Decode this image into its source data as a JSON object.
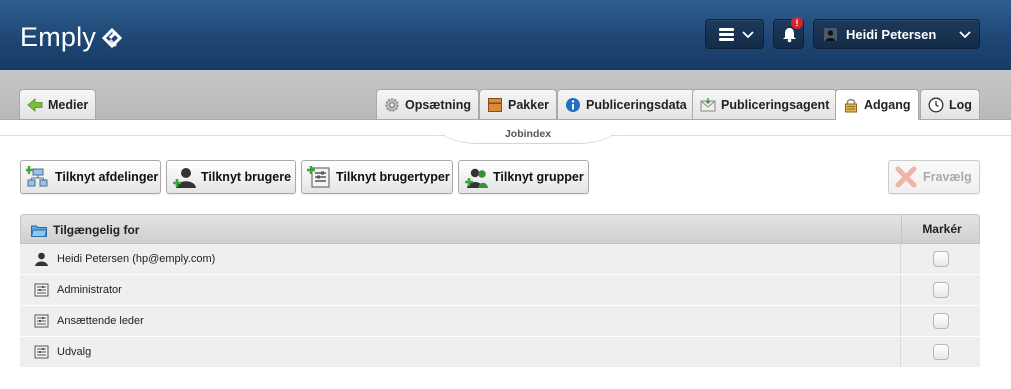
{
  "header": {
    "logo_text": "Emply",
    "notification_badge": "!",
    "user_name": "Heidi Petersen",
    "colors": {
      "header_bg": "#1d4472",
      "badge": "#d9242b"
    }
  },
  "back_tab": {
    "label": "Medier",
    "icon": "arrow-left-icon"
  },
  "tabs": [
    {
      "label": "Opsætning",
      "icon": "gear-icon"
    },
    {
      "label": "Pakker",
      "icon": "package-icon"
    },
    {
      "label": "Publiceringsdata",
      "icon": "info-icon"
    },
    {
      "label": "Publiceringsagent",
      "icon": "envelope-icon"
    },
    {
      "label": "Adgang",
      "icon": "lock-icon",
      "active": true
    },
    {
      "label": "Log",
      "icon": "clock-icon"
    }
  ],
  "subtab": {
    "label": "Jobindex"
  },
  "actions": {
    "add_departments": "Tilknyt afdelinger",
    "add_users": "Tilknyt brugere",
    "add_user_types": "Tilknyt brugertyper",
    "add_groups": "Tilknyt grupper",
    "deselect": "Fravælg"
  },
  "table": {
    "header_label": "Tilgængelig for",
    "header_mark": "Markér",
    "rows": [
      {
        "name": "Heidi Petersen (hp@emply.com)",
        "icon": "user-icon",
        "checked": false
      },
      {
        "name": "Administrator",
        "icon": "user-type-icon",
        "checked": false
      },
      {
        "name": "Ansættende leder",
        "icon": "user-type-icon",
        "checked": false
      },
      {
        "name": "Udvalg",
        "icon": "user-type-icon",
        "checked": false
      }
    ]
  }
}
